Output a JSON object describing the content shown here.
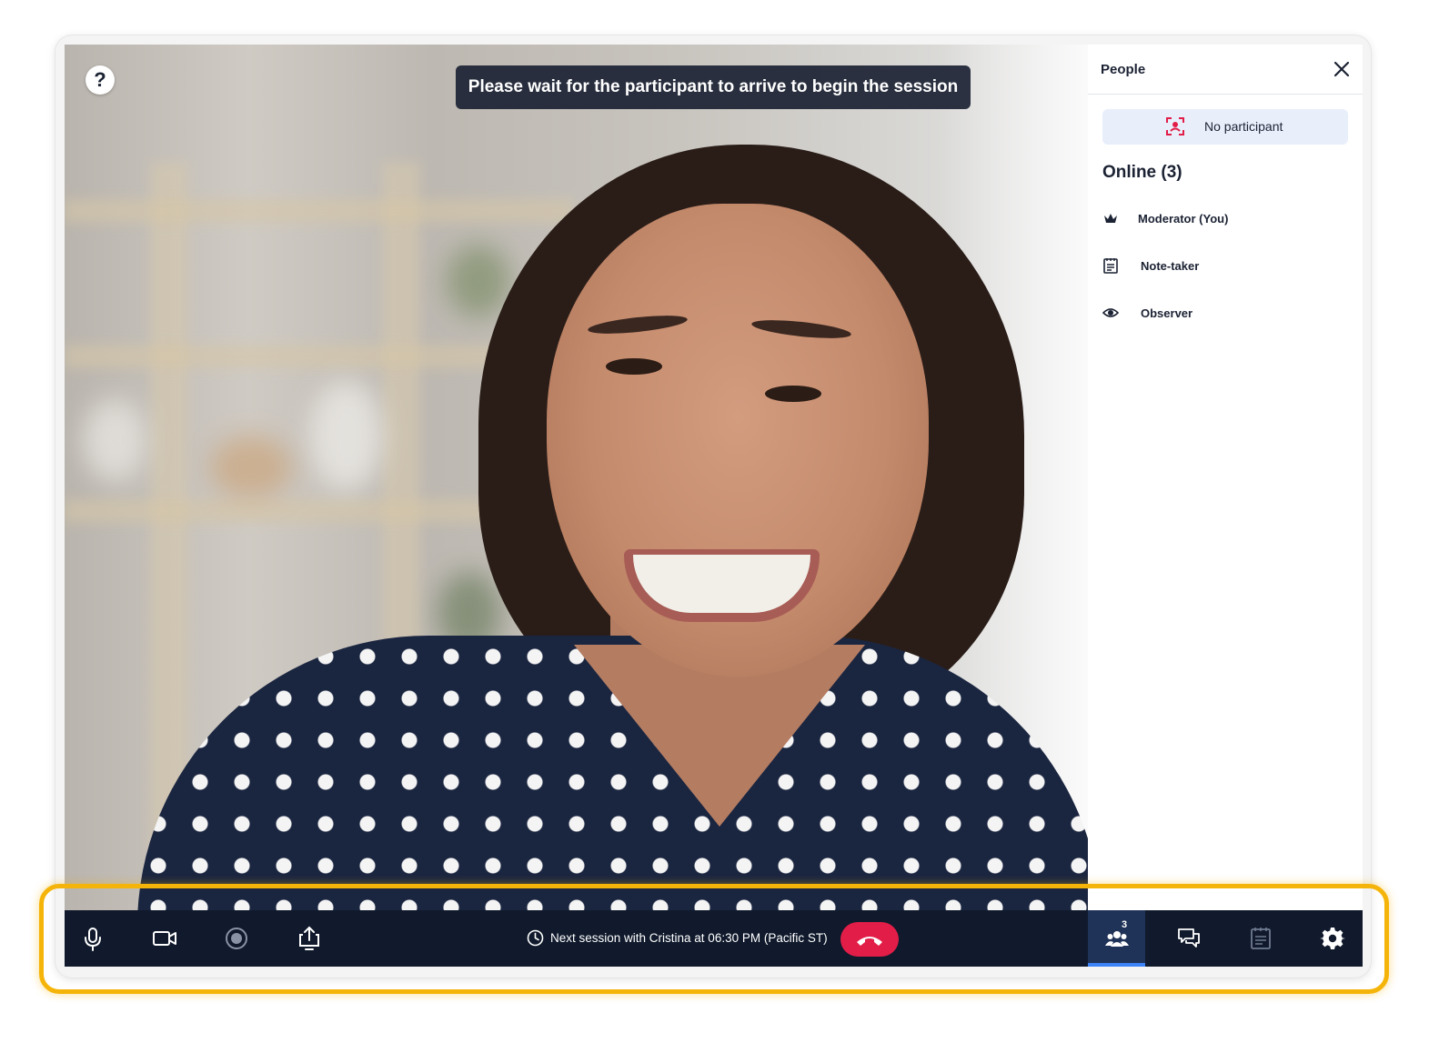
{
  "video": {
    "banner": "Please wait for the participant to arrive to begin the session",
    "help_label": "?"
  },
  "panel": {
    "title": "People",
    "no_participant": "No participant",
    "online_title": "Online (3)",
    "roles": [
      {
        "label": "Moderator (You)",
        "icon": "crown-icon"
      },
      {
        "label": "Note-taker",
        "icon": "notepad-icon"
      },
      {
        "label": "Observer",
        "icon": "eye-icon"
      }
    ]
  },
  "toolbar": {
    "next_session": "Next session with Cristina at 06:30 PM (Pacific ST)",
    "people_count": "3",
    "left_buttons": [
      "microphone-icon",
      "camera-icon",
      "record-icon",
      "share-screen-icon"
    ],
    "right_tabs": [
      "people-icon",
      "chat-icon",
      "notes-icon",
      "gear-icon"
    ]
  },
  "colors": {
    "toolbar_bg": "#101a2c",
    "end_call": "#e11d48",
    "highlight": "#f5b40a",
    "active_tab": "#1f3257",
    "active_underline": "#3b82f6"
  }
}
